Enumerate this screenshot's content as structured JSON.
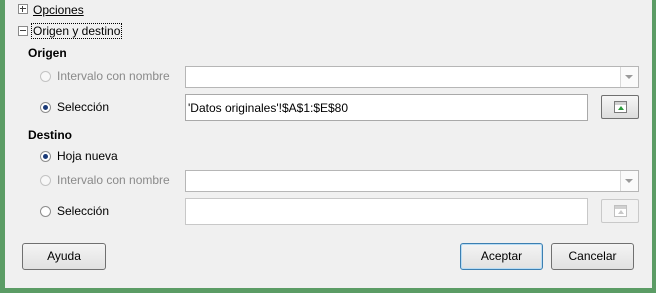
{
  "sections": {
    "options": {
      "label": "Opciones",
      "mnemonic_index": 0
    },
    "source_dest": {
      "label": "Origen y destino"
    }
  },
  "origen": {
    "title": "Origen",
    "named_range": {
      "label": "Intervalo con nombre",
      "selected": false,
      "enabled": false,
      "value": ""
    },
    "selection": {
      "label": "Selección",
      "selected": true,
      "enabled": true,
      "value": "'Datos originales'!$A$1:$E$80"
    }
  },
  "destino": {
    "title": "Destino",
    "new_sheet": {
      "label": "Hoja nueva",
      "selected": true,
      "enabled": true
    },
    "named_range": {
      "label": "Intervalo con nombre",
      "selected": false,
      "enabled": false,
      "value": ""
    },
    "selection": {
      "label": "Selección",
      "selected": false,
      "enabled": true,
      "value": ""
    }
  },
  "buttons": {
    "help": "Ayuda",
    "ok": "Aceptar",
    "cancel": "Cancelar"
  },
  "icons": {
    "expander_collapsed": "plus-expander-icon",
    "expander_expanded": "minus-expander-icon",
    "shrink": "shrink-dialog-icon",
    "dropdown": "chevron-down-icon"
  },
  "colors": {
    "frame": "#5b9c65",
    "dialog_bg": "#f0f0f0",
    "radio_dot": "#1a3a78",
    "default_button_border": "#3c7fb1"
  }
}
